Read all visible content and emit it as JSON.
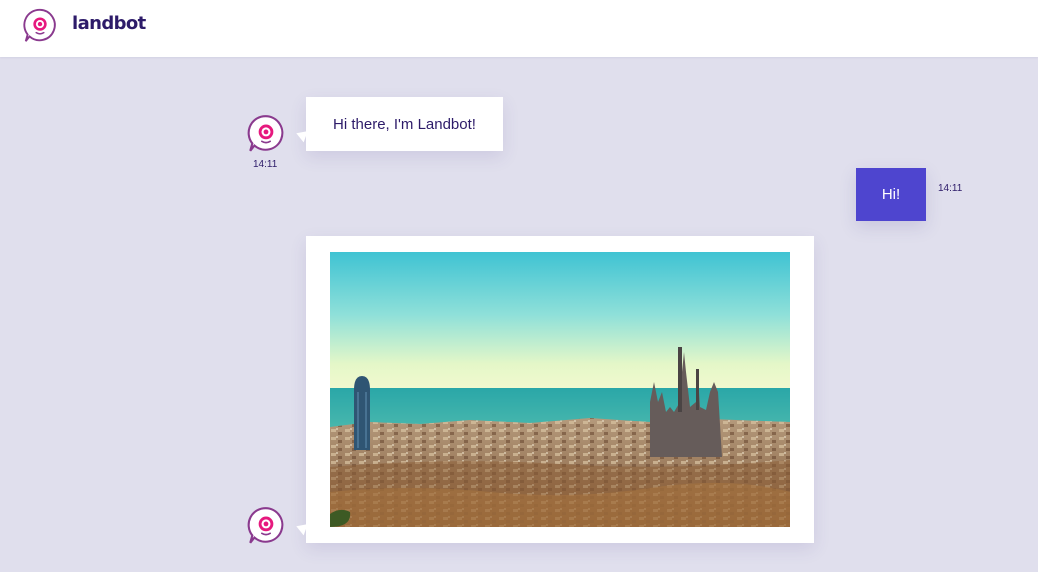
{
  "header": {
    "brand": "landbot",
    "logo_icon": "landbot-logo-icon"
  },
  "colors": {
    "brand_pink": "#e6197e",
    "brand_purple": "#2d1b69",
    "user_bubble": "#4e45cf",
    "background": "#e0dfed"
  },
  "chat": {
    "messages": [
      {
        "sender": "bot",
        "type": "text",
        "text": "Hi there, I'm Landbot!",
        "time": "14:11"
      },
      {
        "sender": "user",
        "type": "text",
        "text": "Hi!",
        "time": "14:11"
      },
      {
        "sender": "bot",
        "type": "image",
        "image": "barcelona-skyline-photo"
      }
    ]
  }
}
